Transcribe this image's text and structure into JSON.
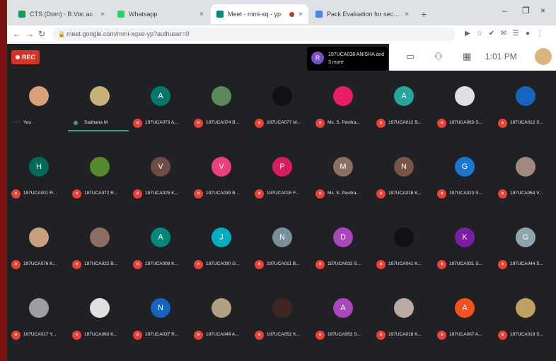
{
  "browser": {
    "tabs": [
      {
        "label": "CTS (Dom) - B.Voc ac",
        "favicon_color": "#0f9d58",
        "active": false
      },
      {
        "label": "Whatsapp",
        "favicon_color": "#25d366",
        "active": false
      },
      {
        "label": "Meet - mmi-xq - yp",
        "favicon_color": "#00897b",
        "active": true,
        "recording": true
      },
      {
        "label": "Pack Evaluation for second year",
        "favicon_color": "#4285f4",
        "active": false
      }
    ],
    "close_glyph": "×",
    "new_tab_glyph": "+",
    "window_controls": [
      "–",
      "❐",
      "×"
    ],
    "nav": {
      "back": "←",
      "forward": "→",
      "reload": "↻"
    },
    "url": "meet.google.com/mmi-xqxe-yp?authuser=0",
    "extensions": [
      "▶",
      "☆",
      "✔",
      "✉",
      "☰",
      "●",
      "⋮"
    ]
  },
  "meet": {
    "rec_label": "REC",
    "presenter": {
      "initial": "R",
      "text": "197UCA038 ANISHA and 3 more"
    },
    "clock": "1:01 PM",
    "controls": [
      "▭",
      "⚇",
      "▦"
    ]
  },
  "participants": [
    {
      "initial": "",
      "color": "#d9a07a",
      "name": "You",
      "muted": false,
      "self": true
    },
    {
      "initial": "",
      "color": "#c8b078",
      "name": "Sadhana M",
      "muted": false,
      "speaking": true
    },
    {
      "initial": "A",
      "color": "#00796b",
      "name": "197UCA073 A...",
      "muted": true
    },
    {
      "initial": "",
      "color": "#5a8a5a",
      "name": "197UCA074 B...",
      "muted": true
    },
    {
      "initial": "",
      "color": "#111111",
      "name": "197UCA077 M...",
      "muted": true
    },
    {
      "initial": "",
      "color": "#e91e63",
      "name": "Ms. S. Pavitra...",
      "muted": true
    },
    {
      "initial": "A",
      "color": "#26a69a",
      "name": "197UCA012 B...",
      "muted": true
    },
    {
      "initial": "",
      "color": "#e0e0e0",
      "name": "197UCA063 S...",
      "muted": true
    },
    {
      "initial": "",
      "color": "#1565c0",
      "name": "197UCA012 S...",
      "muted": true
    },
    {
      "initial": "H",
      "color": "#00695c",
      "name": "197UCA001 R...",
      "muted": true
    },
    {
      "initial": "",
      "color": "#558b2f",
      "name": "197UCA072 R...",
      "muted": true
    },
    {
      "initial": "V",
      "color": "#6d4c41",
      "name": "197UCA025 K...",
      "muted": true
    },
    {
      "initial": "V",
      "color": "#ec407a",
      "name": "197UCA039 B...",
      "muted": true
    },
    {
      "initial": "P",
      "color": "#d81b60",
      "name": "197UCA015 F...",
      "muted": true
    },
    {
      "initial": "M",
      "color": "#8d6e63",
      "name": "Ms. S. Pavitra...",
      "muted": true
    },
    {
      "initial": "N",
      "color": "#795548",
      "name": "197UCA018 K...",
      "muted": true
    },
    {
      "initial": "G",
      "color": "#1976d2",
      "name": "197UCA023 S...",
      "muted": true
    },
    {
      "initial": "",
      "color": "#a1887f",
      "name": "197UCA064 V...",
      "muted": true
    },
    {
      "initial": "",
      "color": "#c8a080",
      "name": "197UCA076 K...",
      "muted": true
    },
    {
      "initial": "",
      "color": "#8d6e63",
      "name": "197UCA022 B...",
      "muted": true
    },
    {
      "initial": "A",
      "color": "#00897b",
      "name": "197UCA008 K...",
      "muted": true
    },
    {
      "initial": "J",
      "color": "#00acc1",
      "name": "197UCA030 G...",
      "muted": true
    },
    {
      "initial": "N",
      "color": "#78909c",
      "name": "197UCA011 B...",
      "muted": true
    },
    {
      "initial": "D",
      "color": "#ab47bc",
      "name": "197UCA032 S...",
      "muted": true
    },
    {
      "initial": "",
      "color": "#111111",
      "name": "197UCA041 K...",
      "muted": true
    },
    {
      "initial": "K",
      "color": "#7b1fa2",
      "name": "197UCA031 S...",
      "muted": true
    },
    {
      "initial": "G",
      "color": "#90a4ae",
      "name": "197UCA044 S...",
      "muted": true
    },
    {
      "initial": "",
      "color": "#9e9e9e",
      "name": "197UCA017 Y...",
      "muted": true
    },
    {
      "initial": "",
      "color": "#e0e0e0",
      "name": "197UCA063 K...",
      "muted": true
    },
    {
      "initial": "N",
      "color": "#1565c0",
      "name": "197UCA037 R...",
      "muted": true
    },
    {
      "initial": "",
      "color": "#b0a080",
      "name": "197UCA049 A...",
      "muted": true
    },
    {
      "initial": "",
      "color": "#3e2723",
      "name": "197UCA052 K...",
      "muted": true
    },
    {
      "initial": "A",
      "color": "#ab47bc",
      "name": "197UCA053 S...",
      "muted": true
    },
    {
      "initial": "",
      "color": "#bcaaa4",
      "name": "197UCA018 K...",
      "muted": true
    },
    {
      "initial": "A",
      "color": "#f4511e",
      "name": "197UCA007 A...",
      "muted": true
    },
    {
      "initial": "",
      "color": "#c0a060",
      "name": "197UCA019 S...",
      "muted": true
    }
  ],
  "mic_glyph": "×"
}
